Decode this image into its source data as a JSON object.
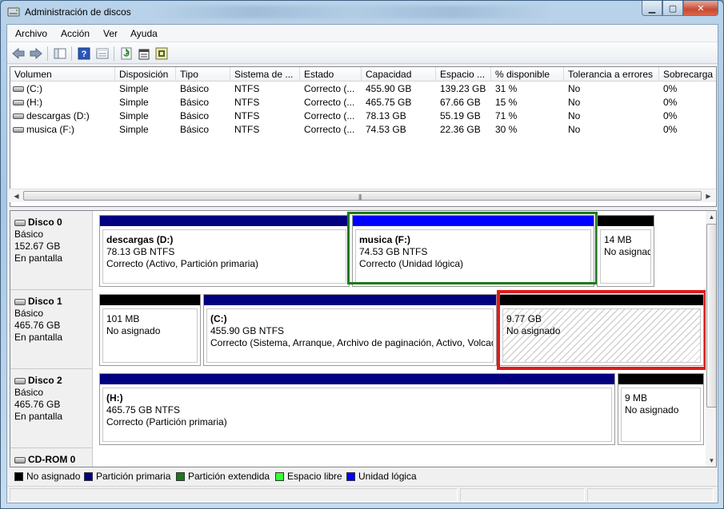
{
  "window": {
    "title": "Administración de discos"
  },
  "titlebar_buttons": {
    "minimize": "▁",
    "maximize": "▢",
    "close": "✕"
  },
  "menu": [
    "Archivo",
    "Acción",
    "Ver",
    "Ayuda"
  ],
  "toolbar_icons": [
    "back-arrow-icon",
    "forward-arrow-icon",
    "console-tree-icon",
    "help-icon",
    "properties-view-icon",
    "refresh-icon",
    "properties-icon",
    "settings-icon"
  ],
  "volumes": {
    "columns": [
      "Volumen",
      "Disposición",
      "Tipo",
      "Sistema de ...",
      "Estado",
      "Capacidad",
      "Espacio ...",
      "% disponible",
      "Tolerancia a errores",
      "Sobrecarga"
    ],
    "rows": [
      [
        "(C:)",
        "Simple",
        "Básico",
        "NTFS",
        "Correcto (...",
        "455.90 GB",
        "139.23 GB",
        "31 %",
        "No",
        "0%"
      ],
      [
        "(H:)",
        "Simple",
        "Básico",
        "NTFS",
        "Correcto (...",
        "465.75 GB",
        "67.66 GB",
        "15 %",
        "No",
        "0%"
      ],
      [
        "descargas (D:)",
        "Simple",
        "Básico",
        "NTFS",
        "Correcto (...",
        "78.13 GB",
        "55.19 GB",
        "71 %",
        "No",
        "0%"
      ],
      [
        "musica (F:)",
        "Simple",
        "Básico",
        "NTFS",
        "Correcto (...",
        "74.53 GB",
        "22.36 GB",
        "30 %",
        "No",
        "0%"
      ]
    ]
  },
  "disks": [
    {
      "name": "Disco 0",
      "type": "Básico",
      "size": "152.67 GB",
      "state": "En pantalla",
      "partitions": [
        {
          "title": "descargas  (D:)",
          "size": "78.13 GB NTFS",
          "status": "Correcto (Activo, Partición primaria)"
        },
        {
          "title": "musica  (F:)",
          "size": "74.53 GB NTFS",
          "status": "Correcto (Unidad lógica)"
        },
        {
          "title": "",
          "size": "14 MB",
          "status": "No asignado"
        }
      ]
    },
    {
      "name": "Disco 1",
      "type": "Básico",
      "size": "465.76 GB",
      "state": "En pantalla",
      "partitions": [
        {
          "title": "",
          "size": "101 MB",
          "status": "No asignado"
        },
        {
          "title": "(C:)",
          "size": "455.90 GB NTFS",
          "status": "Correcto (Sistema, Arranque, Archivo de paginación, Activo, Volcado"
        },
        {
          "title": "",
          "size": "9.77 GB",
          "status": "No asignado"
        }
      ]
    },
    {
      "name": "Disco 2",
      "type": "Básico",
      "size": "465.76 GB",
      "state": "En pantalla",
      "partitions": [
        {
          "title": "(H:)",
          "size": "465.75 GB NTFS",
          "status": "Correcto (Partición primaria)"
        },
        {
          "title": "",
          "size": "9 MB",
          "status": "No asignado"
        }
      ]
    },
    {
      "name": "CD-ROM 0"
    }
  ],
  "legend": [
    {
      "label": "No asignado",
      "color": "#000000"
    },
    {
      "label": "Partición primaria",
      "color": "#000080"
    },
    {
      "label": "Partición extendida",
      "color": "#1a7a1a"
    },
    {
      "label": "Espacio libre",
      "color": "#33ff33"
    },
    {
      "label": "Unidad lógica",
      "color": "#0000ff"
    }
  ],
  "colors": {
    "highlight_green": "#1a7a1a",
    "highlight_red": "#e01b1b"
  }
}
